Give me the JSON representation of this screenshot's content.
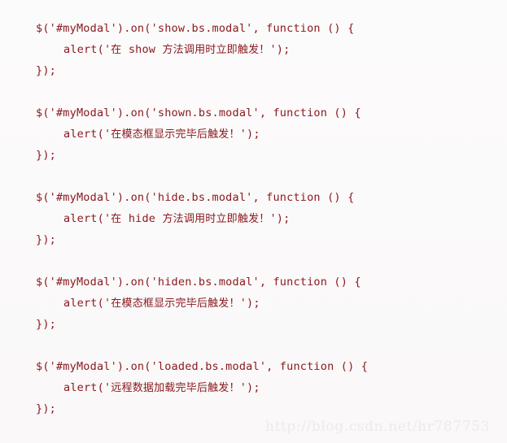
{
  "page": {
    "background_color": "#fbfafa",
    "code_color": "#8b1a20",
    "watermark_color": "#efeaea"
  },
  "watermark": {
    "text": "http://blog.csdn.net/hr787753"
  },
  "code": {
    "language": "javascript",
    "blocks": [
      {
        "id": "show-event",
        "event": "show.bs.modal",
        "lines": [
          "$('#myModal').on('show.bs.modal', function () {",
          "alert('在 show 方法调用时立即触发！');",
          "});"
        ]
      },
      {
        "id": "shown-event",
        "event": "shown.bs.modal",
        "lines": [
          "$('#myModal').on('shown.bs.modal', function () {",
          "alert('在模态框显示完毕后触发！');",
          "});"
        ]
      },
      {
        "id": "hide-event",
        "event": "hide.bs.modal",
        "lines": [
          "$('#myModal').on('hide.bs.modal', function () {",
          "alert('在 hide 方法调用时立即触发！');",
          "});"
        ]
      },
      {
        "id": "hiden-event",
        "event": "hiden.bs.modal",
        "lines": [
          "$('#myModal').on('hiden.bs.modal', function () {",
          "alert('在模态框显示完毕后触发！');",
          "});"
        ]
      },
      {
        "id": "loaded-event",
        "event": "loaded.bs.modal",
        "lines": [
          "$('#myModal').on('loaded.bs.modal', function () {",
          "alert('远程数据加载完毕后触发！');",
          "});"
        ]
      }
    ]
  }
}
